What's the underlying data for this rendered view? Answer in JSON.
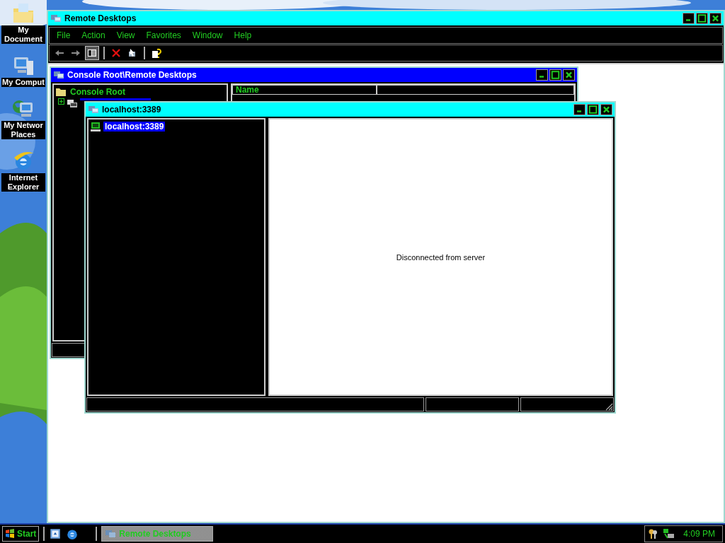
{
  "desktop": {
    "icons": [
      {
        "label": "My Document",
        "kind": "documents"
      },
      {
        "label": "My Comput",
        "kind": "computer"
      },
      {
        "label": "My Networ Places",
        "kind": "network"
      },
      {
        "label": "Internet Explorer",
        "kind": "browser"
      }
    ]
  },
  "window": {
    "title": "Remote Desktops",
    "menu": [
      "File",
      "Action",
      "View",
      "Favorites",
      "Window",
      "Help"
    ],
    "toolbar": [
      {
        "kind": "back",
        "pressed": false
      },
      {
        "kind": "forward",
        "pressed": false
      },
      {
        "kind": "tree",
        "pressed": true
      },
      {
        "kind": "delete",
        "pressed": false
      },
      {
        "kind": "connect",
        "pressed": false
      },
      {
        "kind": "help",
        "pressed": false
      }
    ],
    "children": [
      {
        "title": "Console Root\\Remote Desktops",
        "active": false,
        "tree": [
          {
            "label": "Console Root",
            "kind": "folder",
            "selected": false,
            "children": [
              {
                "kind": "computers",
                "selected": true
              }
            ]
          }
        ],
        "columns": [
          "Name"
        ]
      },
      {
        "title": "localhost:3389",
        "active": true,
        "tree": [
          {
            "label": "localhost:3389",
            "kind": "computer",
            "selected": true
          }
        ],
        "message": "Disconnected from server"
      }
    ]
  },
  "taskbar": {
    "start": "Start",
    "quick_launch": [
      {
        "kind": "desktop"
      },
      {
        "kind": "browser"
      }
    ],
    "tasks": [
      {
        "label": "Remote Desktops",
        "selected": true
      }
    ],
    "clock": "4:09 PM"
  }
}
